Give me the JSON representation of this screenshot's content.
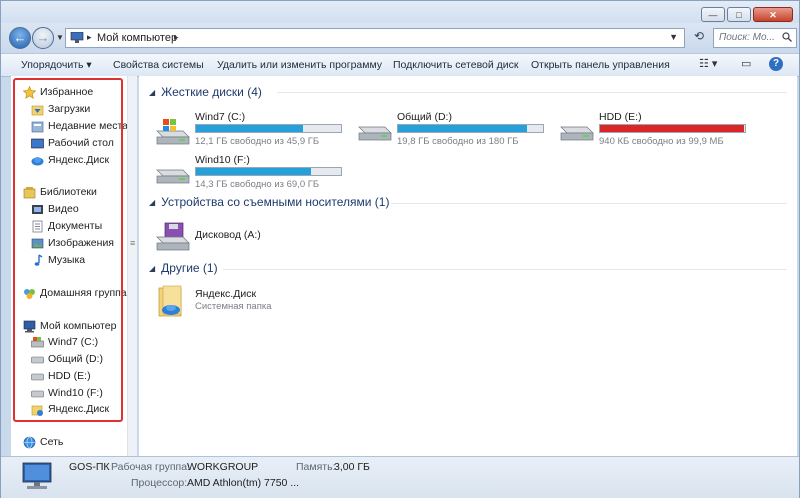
{
  "window": {
    "minimize": "—",
    "maximize": "□",
    "close": "✕"
  },
  "address": {
    "crumb": "Мой компьютер",
    "search_placeholder": "Поиск: Мо..."
  },
  "toolbar": {
    "organize": "Упорядочить ▾",
    "system_properties": "Свойства системы",
    "uninstall": "Удалить или изменить программу",
    "map_drive": "Подключить сетевой диск",
    "control_panel": "Открыть панель управления"
  },
  "nav": {
    "favorites": "Избранное",
    "downloads": "Загрузки",
    "recent": "Недавние места",
    "desktop": "Рабочий стол",
    "yandex_fav": "Яндекс.Диск",
    "libraries": "Библиотеки",
    "video": "Видео",
    "documents": "Документы",
    "images": "Изображения",
    "music": "Музыка",
    "homegroup": "Домашняя группа",
    "computer": "Мой компьютер",
    "wind7": "Wind7 (C:)",
    "common": "Общий (D:)",
    "hdd": "HDD (E:)",
    "wind10": "Wind10 (F:)",
    "yandex": "Яндекс.Диск",
    "network": "Сеть"
  },
  "sections": {
    "hard_drives": "Жесткие диски (4)",
    "removable": "Устройства со съемными носителями (1)",
    "other": "Другие (1)"
  },
  "drives": [
    {
      "name": "Wind7 (C:)",
      "info": "12,1 ГБ свободно из 45,9 ГБ",
      "used_fraction": 0.74,
      "color": "#26a0da"
    },
    {
      "name": "Общий (D:)",
      "info": "19,8 ГБ свободно из 180 ГБ",
      "used_fraction": 0.89,
      "color": "#26a0da"
    },
    {
      "name": "HDD (E:)",
      "info": "940 КБ свободно из 99,9 МБ",
      "used_fraction": 0.99,
      "color": "#da2626"
    },
    {
      "name": "Wind10 (F:)",
      "info": "14,3 ГБ свободно из 69,0 ГБ",
      "used_fraction": 0.79,
      "color": "#26a0da"
    }
  ],
  "removable": {
    "name": "Дисковод (A:)"
  },
  "other": {
    "name": "Яндекс.Диск",
    "type": "Системная папка"
  },
  "status": {
    "pc_name": "GOS-ПК",
    "workgroup_label": "Рабочая группа:",
    "workgroup": "WORKGROUP",
    "memory_label": "Память:",
    "memory": "3,00 ГБ",
    "cpu_label": "Процессор:",
    "cpu": "AMD Athlon(tm) 7750 ..."
  }
}
